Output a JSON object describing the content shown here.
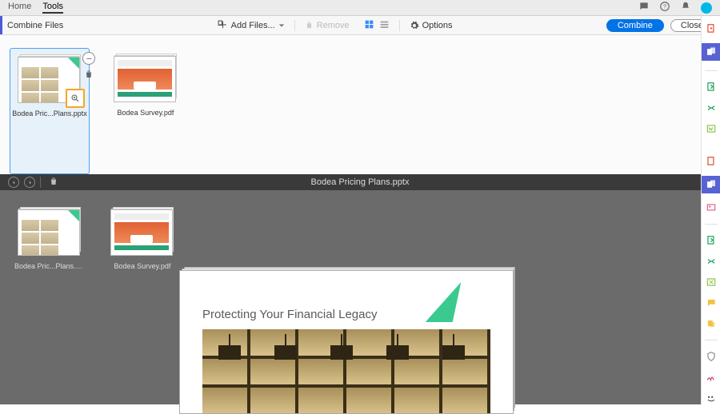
{
  "topbar": {
    "tabs": [
      "Home",
      "Tools"
    ],
    "active_tab_index": 1
  },
  "toolbar": {
    "title": "Combine Files",
    "add_files": "Add Files...",
    "remove": "Remove",
    "options": "Options",
    "combine": "Combine",
    "close": "Close"
  },
  "files": [
    {
      "caption": "Bodea Pric...Plans.pptx",
      "selected": true
    },
    {
      "caption": "Bodea Survey.pdf",
      "selected": false
    }
  ],
  "preview": {
    "title": "Bodea Pricing Plans.pptx",
    "slide_heading": "Protecting Your Financial Legacy",
    "files": [
      {
        "caption": "Bodea Pric...Plans.pptx"
      },
      {
        "caption": "Bodea Survey.pdf"
      }
    ]
  },
  "icons": {
    "search": "search-icon",
    "gear": "gear-icon",
    "trash": "trash-icon",
    "expand": "expand-icon",
    "close": "close-icon",
    "grid": "grid-view-icon",
    "list": "list-view-icon",
    "add": "add-files-icon",
    "chevron_down": "chevron-down-icon"
  },
  "colors": {
    "primary": "#0073e6",
    "accent_purple": "#5862d3",
    "highlight": "#f6a623",
    "selection": "#e7f1fa",
    "brand_green": "#3ac98f"
  }
}
